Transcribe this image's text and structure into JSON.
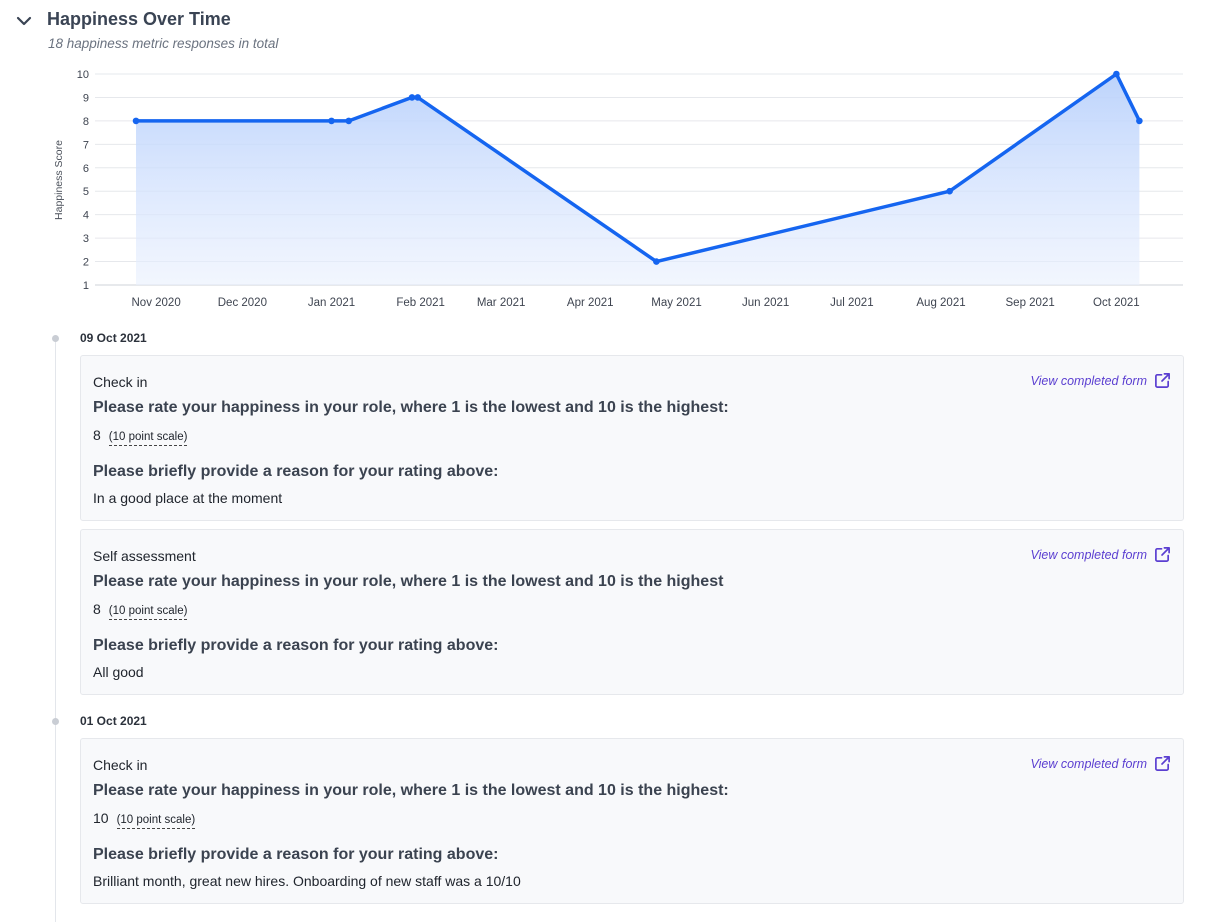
{
  "header": {
    "title": "Happiness Over Time",
    "subtitle": "18 happiness metric responses in total"
  },
  "chart_data": {
    "type": "area",
    "ylabel": "Happiness Score",
    "ylim": [
      1,
      10
    ],
    "yticks": [
      1,
      2,
      3,
      4,
      5,
      6,
      7,
      8,
      9,
      10
    ],
    "xticks": [
      "Nov 2020",
      "Dec 2020",
      "Jan 2021",
      "Feb 2021",
      "Mar 2021",
      "Apr 2021",
      "May 2021",
      "Jun 2021",
      "Jul 2021",
      "Aug 2021",
      "Sep 2021",
      "Oct 2021"
    ],
    "xrange": [
      "2020-10-25",
      "2021-10-20"
    ],
    "points": [
      {
        "date": "2020-10-25",
        "value": 8
      },
      {
        "date": "2021-01-01",
        "value": 8
      },
      {
        "date": "2021-01-07",
        "value": 8
      },
      {
        "date": "2021-01-29",
        "value": 9
      },
      {
        "date": "2021-01-31",
        "value": 9
      },
      {
        "date": "2021-04-24",
        "value": 2
      },
      {
        "date": "2021-08-04",
        "value": 5
      },
      {
        "date": "2021-10-01",
        "value": 10
      },
      {
        "date": "2021-10-09",
        "value": 8
      }
    ],
    "line_color": "#1565f0",
    "fill_color": "#c6dafd",
    "grid": true
  },
  "timeline": [
    {
      "date": "09 Oct 2021",
      "entries": [
        {
          "type": "Check in",
          "question1": "Please rate your happiness in your role, where 1 is the lowest and 10 is the highest:",
          "score": "8",
          "scale": "(10 point scale)",
          "question2": "Please briefly provide a reason for your rating above:",
          "answer": "In a good place at the moment",
          "link": "View completed form"
        },
        {
          "type": "Self assessment",
          "question1": "Please rate your happiness in your role, where 1 is the lowest and 10 is the highest",
          "score": "8",
          "scale": "(10 point scale)",
          "question2": "Please briefly provide a reason for your rating above:",
          "answer": "All good",
          "link": "View completed form"
        }
      ]
    },
    {
      "date": "01 Oct 2021",
      "entries": [
        {
          "type": "Check in",
          "question1": "Please rate your happiness in your role, where 1 is the lowest and 10 is the highest:",
          "score": "10",
          "scale": "(10 point scale)",
          "question2": "Please briefly provide a reason for your rating above:",
          "answer": "Brilliant month, great new hires. Onboarding of new staff was a 10/10",
          "link": "View completed form"
        }
      ]
    }
  ],
  "colors": {
    "link": "#5b3fd1",
    "timeline_dot": "#c9cdd4"
  }
}
